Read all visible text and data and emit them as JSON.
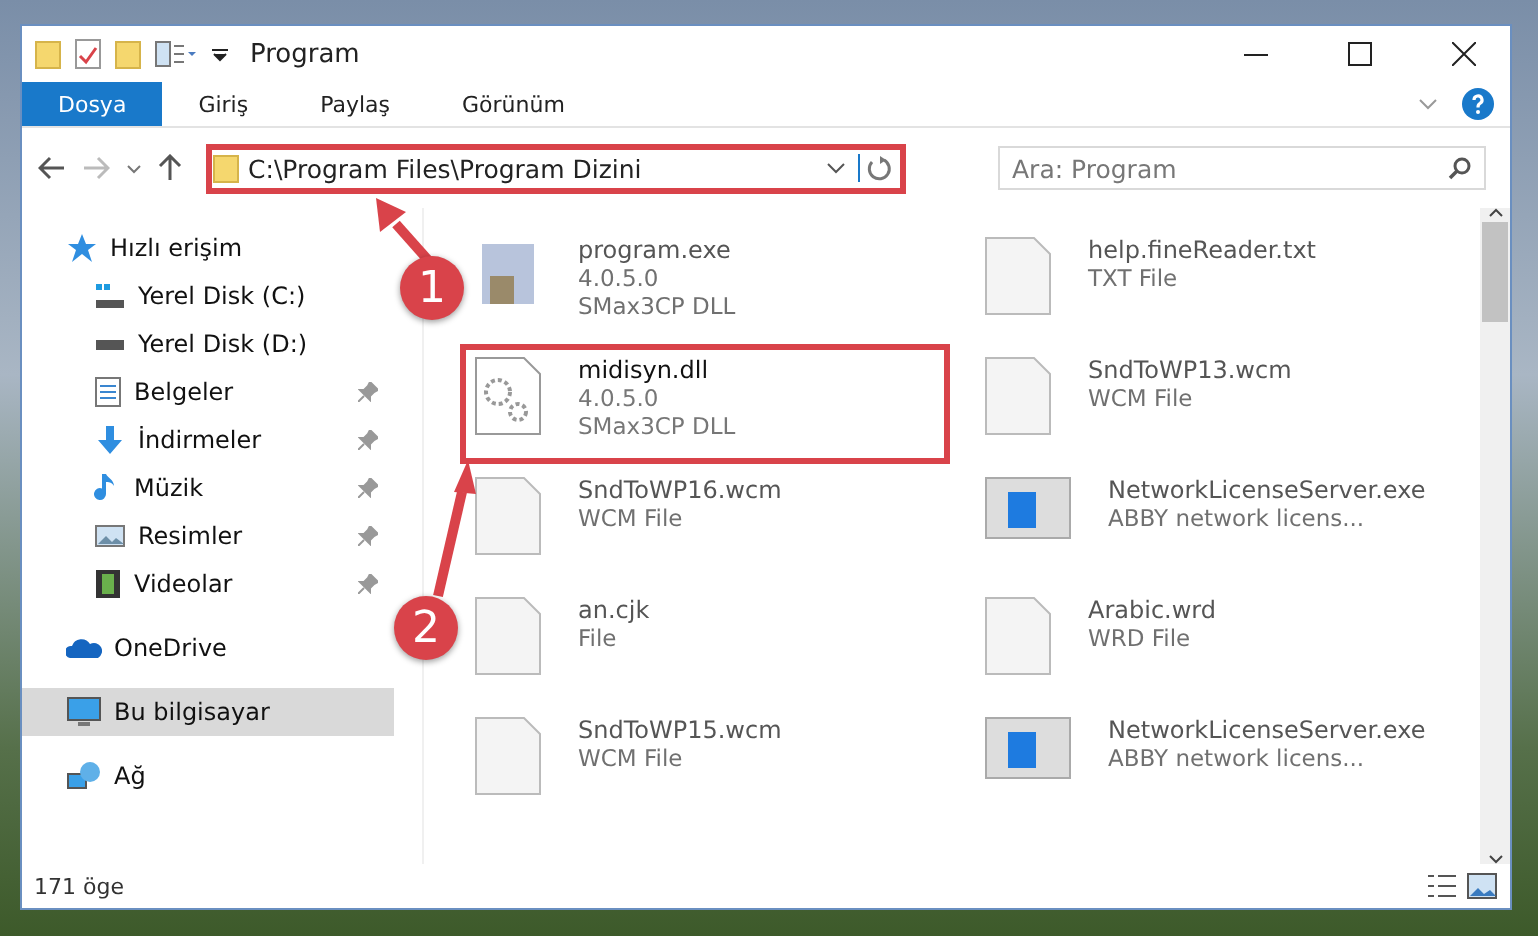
{
  "window": {
    "title": "Program"
  },
  "ribbon_tabs": [
    {
      "label": "Dosya",
      "selected": true
    },
    {
      "label": "Giriş",
      "selected": false
    },
    {
      "label": "Paylaş",
      "selected": false
    },
    {
      "label": "Görünüm",
      "selected": false
    }
  ],
  "address": {
    "path": "C:\\Program Files\\Program Dizini"
  },
  "search": {
    "placeholder": "Ara: Program"
  },
  "nav": [
    {
      "label": "Hızlı erişim",
      "kind": "star",
      "selected": false,
      "children": [
        {
          "label": "Yerel Disk (C:)",
          "kind": "windrive",
          "pinned": false,
          "selected": false
        },
        {
          "label": "Yerel Disk (D:)",
          "kind": "drive",
          "pinned": false,
          "selected": false
        },
        {
          "label": "Belgeler",
          "kind": "docs",
          "pinned": true,
          "selected": false
        },
        {
          "label": "İndirmeler",
          "kind": "download",
          "pinned": true,
          "selected": false
        },
        {
          "label": "Müzik",
          "kind": "music",
          "pinned": true,
          "selected": false
        },
        {
          "label": "Resimler",
          "kind": "pictures",
          "pinned": true,
          "selected": false
        },
        {
          "label": "Videolar",
          "kind": "videos",
          "pinned": true,
          "selected": false
        }
      ]
    },
    {
      "label": "OneDrive",
      "kind": "cloud",
      "selected": false
    },
    {
      "label": "Bu bilgisayar",
      "kind": "computer",
      "selected": true
    },
    {
      "label": "Ağ",
      "kind": "network",
      "selected": false
    }
  ],
  "files": [
    {
      "name": "program.exe",
      "details": [
        "4.0.5.0",
        "SMax3CP DLL"
      ],
      "kind": "exe",
      "highlighted": false
    },
    {
      "name": "help.fineReader.txt",
      "details": [
        "TXT File"
      ],
      "kind": "blank",
      "highlighted": false
    },
    {
      "name": "midisyn.dll",
      "details": [
        "4.0.5.0",
        "SMax3CP DLL"
      ],
      "kind": "gear",
      "highlighted": true
    },
    {
      "name": "SndToWP13.wcm",
      "details": [
        "WCM File"
      ],
      "kind": "blank",
      "highlighted": false
    },
    {
      "name": "SndToWP16.wcm",
      "details": [
        "WCM File"
      ],
      "kind": "blank",
      "highlighted": false
    },
    {
      "name": "NetworkLicenseServer.exe",
      "details": [
        "ABBY network licens..."
      ],
      "kind": "app",
      "highlighted": false
    },
    {
      "name": "an.cjk",
      "details": [
        "File"
      ],
      "kind": "blank",
      "highlighted": false
    },
    {
      "name": "Arabic.wrd",
      "details": [
        "WRD File"
      ],
      "kind": "blank",
      "highlighted": false
    },
    {
      "name": "SndToWP15.wcm",
      "details": [
        "WCM File"
      ],
      "kind": "blank",
      "highlighted": false
    },
    {
      "name": "NetworkLicenseServer.exe",
      "details": [
        "ABBY network licens..."
      ],
      "kind": "app",
      "highlighted": false
    }
  ],
  "status_bar": {
    "count": "171 öge"
  },
  "annotations": [
    {
      "label": "1"
    },
    {
      "label": "2"
    }
  ]
}
